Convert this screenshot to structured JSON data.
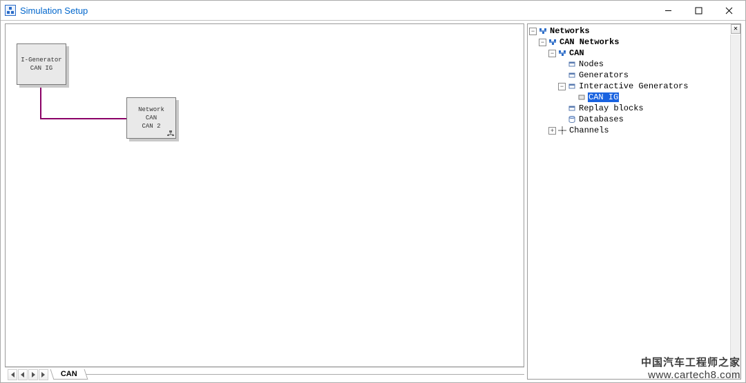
{
  "window": {
    "title": "Simulation Setup",
    "controls": {
      "minimize": "—",
      "maximize": "☐",
      "close": "✕"
    }
  },
  "canvas": {
    "block1": {
      "line1": "I-Generator",
      "line2": "CAN IG"
    },
    "block2": {
      "line1": "Network",
      "line2": "CAN",
      "line3": "CAN 2"
    }
  },
  "tabs": {
    "sheet": "CAN"
  },
  "tree": {
    "n0": "Networks",
    "n1": "CAN Networks",
    "n2": "CAN",
    "n3": "Nodes",
    "n4": "Generators",
    "n5": "Interactive Generators",
    "n6": "CAN IG",
    "n7": "Replay blocks",
    "n8": "Databases",
    "n9": "Channels"
  },
  "watermark": {
    "line1": "中国汽车工程师之家",
    "line2": "www.cartech8.com"
  }
}
